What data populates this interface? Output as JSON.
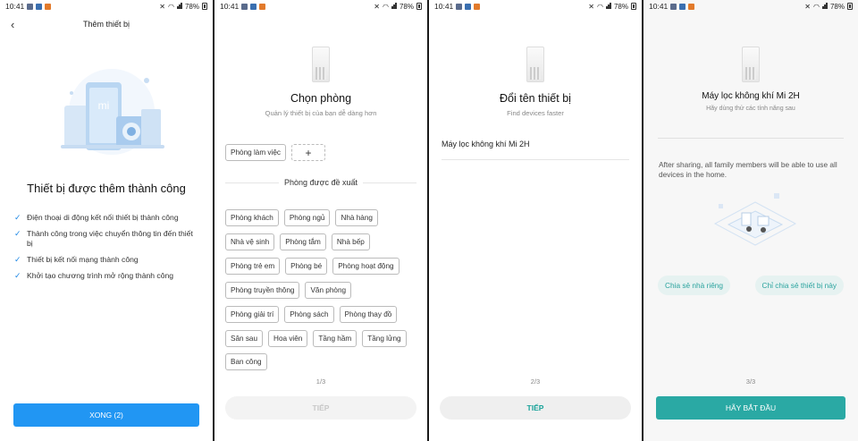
{
  "status": {
    "time": "10:41",
    "battery": "78%"
  },
  "panel1": {
    "title": "Thêm thiết bị",
    "headline": "Thiết bị được thêm thành công",
    "checks": [
      "Điện thoại di động kết nối thiết bị thành công",
      "Thành công trong việc chuyển thông tin đến thiết bị",
      "Thiết bị kết nối mạng thành công",
      "Khởi tạo chương trình mở rộng thành công"
    ],
    "button": "XONG (2)"
  },
  "panel2": {
    "title": "Chọn phòng",
    "subtitle": "Quản lý thiết bị của bạn dễ dàng hơn",
    "current_room": "Phòng làm việc",
    "add_label": "+",
    "suggested_label": "Phòng được đề xuất",
    "rooms": [
      [
        "Phòng khách",
        "Phòng ngủ",
        "Nhà hàng"
      ],
      [
        "Nhà vệ sinh",
        "Phòng tắm",
        "Nhà bếp"
      ],
      [
        "Phòng trẻ em",
        "Phòng bé",
        "Phòng hoạt động"
      ],
      [
        "Phòng truyền thông",
        "Văn phòng"
      ],
      [
        "Phòng giải trí",
        "Phòng sách",
        "Phòng thay đồ"
      ],
      [
        "Sân sau",
        "Hoa viên",
        "Tầng hầm",
        "Tầng lửng"
      ],
      [
        "Ban công"
      ]
    ],
    "pager": "1/3",
    "button": "TIẾP"
  },
  "panel3": {
    "title": "Đổi tên thiết bị",
    "subtitle": "Find devices faster",
    "device_name": "Máy lọc không khí Mi 2H",
    "pager": "2/3",
    "button": "TIẾP"
  },
  "panel4": {
    "title": "Máy lọc không khí Mi 2H",
    "subtitle": "Hãy dùng thử các tính năng sau",
    "description": "After sharing, all family members will be able to use all devices in the home.",
    "share_home": "Chia sẻ nhà riêng",
    "share_device": "Chỉ chia sẻ thiết bị này",
    "pager": "3/3",
    "button": "HÃY BẮT ĐẦU"
  }
}
